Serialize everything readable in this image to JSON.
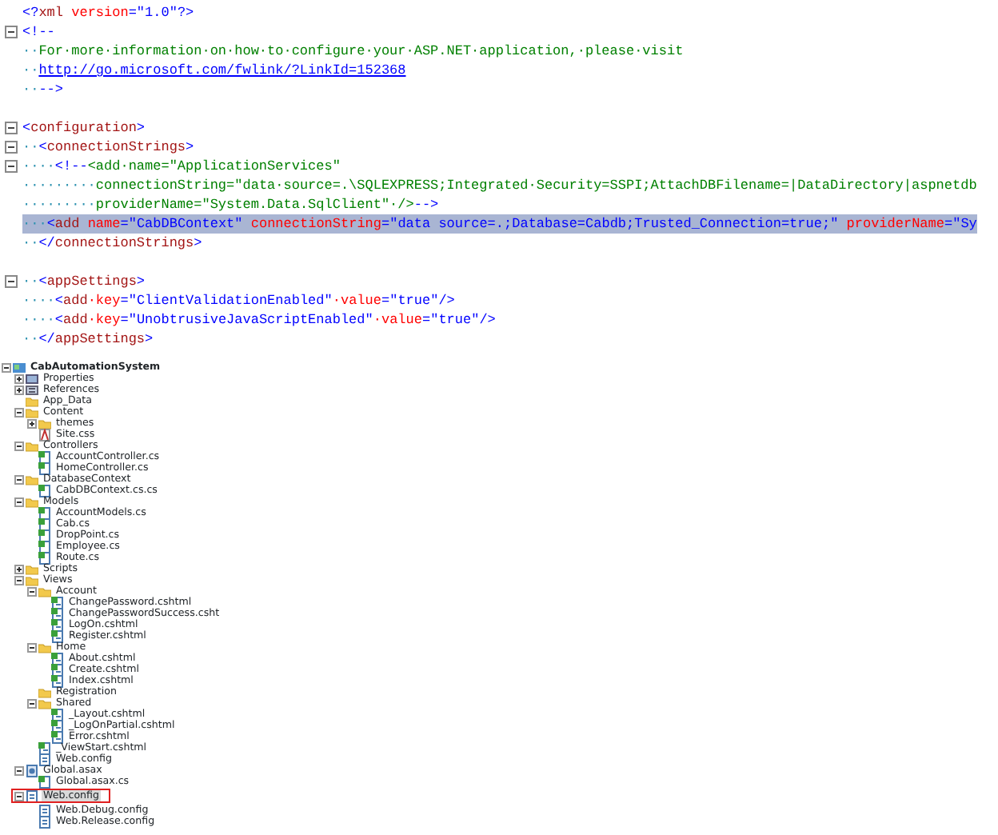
{
  "editor": {
    "lines": [
      {
        "kind": "code",
        "fold": false,
        "segments": [
          {
            "kind": "punct",
            "text": "<?"
          },
          {
            "kind": "tag",
            "text": "xml"
          },
          {
            "kind": "attr",
            "text": " version"
          },
          {
            "kind": "punct",
            "text": "=\""
          },
          {
            "kind": "value",
            "text": "1.0"
          },
          {
            "kind": "punct",
            "text": "\"?>"
          }
        ]
      },
      {
        "kind": "code",
        "fold": true,
        "segments": [
          {
            "kind": "punct",
            "text": "<!--"
          }
        ]
      },
      {
        "kind": "code",
        "fold": false,
        "segments": [
          {
            "kind": "space",
            "text": "··"
          },
          {
            "kind": "comment",
            "text": "For·more·information·on·how·to·configure·your·ASP.NET·application,·please·visit"
          }
        ]
      },
      {
        "kind": "code",
        "fold": false,
        "segments": [
          {
            "kind": "space",
            "text": "··"
          },
          {
            "kind": "link",
            "text": "http://go.microsoft.com/fwlink/?LinkId=152368"
          }
        ]
      },
      {
        "kind": "code",
        "fold": false,
        "segments": [
          {
            "kind": "space",
            "text": "··"
          },
          {
            "kind": "punct",
            "text": "-->"
          }
        ]
      },
      {
        "kind": "blank"
      },
      {
        "kind": "code",
        "fold": true,
        "segments": [
          {
            "kind": "punct",
            "text": "<"
          },
          {
            "kind": "tag",
            "text": "configuration"
          },
          {
            "kind": "punct",
            "text": ">"
          }
        ]
      },
      {
        "kind": "code",
        "fold": true,
        "segments": [
          {
            "kind": "space",
            "text": "··"
          },
          {
            "kind": "punct",
            "text": "<"
          },
          {
            "kind": "tag",
            "text": "connectionStrings"
          },
          {
            "kind": "punct",
            "text": ">"
          }
        ]
      },
      {
        "kind": "code",
        "fold": true,
        "segments": [
          {
            "kind": "space",
            "text": "····"
          },
          {
            "kind": "punct",
            "text": "<!--"
          },
          {
            "kind": "comment",
            "text": "<add·name=\"ApplicationServices\""
          }
        ]
      },
      {
        "kind": "code",
        "fold": false,
        "segments": [
          {
            "kind": "space",
            "text": "·········"
          },
          {
            "kind": "comment",
            "text": "connectionString=\"data·source=.\\SQLEXPRESS;Integrated·Security=SSPI;AttachDBFilename=|DataDirectory|aspnetdb"
          }
        ]
      },
      {
        "kind": "code",
        "fold": false,
        "segments": [
          {
            "kind": "space",
            "text": "·········"
          },
          {
            "kind": "comment",
            "text": "providerName=\"System.Data.SqlClient\"·/>"
          },
          {
            "kind": "punct",
            "text": "-->"
          }
        ]
      },
      {
        "kind": "code",
        "fold": false,
        "highlighted": true,
        "segments": [
          {
            "kind": "space",
            "text": "···"
          },
          {
            "kind": "punct",
            "text": "<"
          },
          {
            "kind": "tag",
            "text": "add"
          },
          {
            "kind": "attr",
            "text": " name"
          },
          {
            "kind": "punct",
            "text": "=\""
          },
          {
            "kind": "value",
            "text": "CabDBContext"
          },
          {
            "kind": "punct",
            "text": "\""
          },
          {
            "kind": "attr",
            "text": " connectionString"
          },
          {
            "kind": "punct",
            "text": "=\""
          },
          {
            "kind": "value",
            "text": "data source=.;Database=Cabdb;Trusted_Connection=true;"
          },
          {
            "kind": "punct",
            "text": "\""
          },
          {
            "kind": "attr",
            "text": " providerName"
          },
          {
            "kind": "punct",
            "text": "=\""
          },
          {
            "kind": "value",
            "text": "Sy"
          }
        ]
      },
      {
        "kind": "code",
        "fold": false,
        "segments": [
          {
            "kind": "space",
            "text": "··"
          },
          {
            "kind": "punct",
            "text": "</"
          },
          {
            "kind": "tag",
            "text": "connectionStrings"
          },
          {
            "kind": "punct",
            "text": ">"
          }
        ]
      },
      {
        "kind": "blank"
      },
      {
        "kind": "code",
        "fold": true,
        "segments": [
          {
            "kind": "space",
            "text": "··"
          },
          {
            "kind": "punct",
            "text": "<"
          },
          {
            "kind": "tag",
            "text": "appSettings"
          },
          {
            "kind": "punct",
            "text": ">"
          }
        ]
      },
      {
        "kind": "code",
        "fold": false,
        "segments": [
          {
            "kind": "space",
            "text": "····"
          },
          {
            "kind": "punct",
            "text": "<"
          },
          {
            "kind": "tag",
            "text": "add"
          },
          {
            "kind": "attr",
            "text": "·key"
          },
          {
            "kind": "punct",
            "text": "=\""
          },
          {
            "kind": "value",
            "text": "ClientValidationEnabled"
          },
          {
            "kind": "punct",
            "text": "\""
          },
          {
            "kind": "attr",
            "text": "·value"
          },
          {
            "kind": "punct",
            "text": "=\""
          },
          {
            "kind": "value",
            "text": "true"
          },
          {
            "kind": "punct",
            "text": "\"/>"
          }
        ]
      },
      {
        "kind": "code",
        "fold": false,
        "segments": [
          {
            "kind": "space",
            "text": "····"
          },
          {
            "kind": "punct",
            "text": "<"
          },
          {
            "kind": "tag",
            "text": "add"
          },
          {
            "kind": "attr",
            "text": "·key"
          },
          {
            "kind": "punct",
            "text": "=\""
          },
          {
            "kind": "value",
            "text": "UnobtrusiveJavaScriptEnabled"
          },
          {
            "kind": "punct",
            "text": "\""
          },
          {
            "kind": "attr",
            "text": "·value"
          },
          {
            "kind": "punct",
            "text": "=\""
          },
          {
            "kind": "value",
            "text": "true"
          },
          {
            "kind": "punct",
            "text": "\"/>"
          }
        ]
      },
      {
        "kind": "code",
        "fold": false,
        "segments": [
          {
            "kind": "space",
            "text": "··"
          },
          {
            "kind": "punct",
            "text": "</"
          },
          {
            "kind": "tag",
            "text": "appSettings"
          },
          {
            "kind": "punct",
            "text": ">"
          }
        ]
      }
    ]
  },
  "solution_tree": [
    {
      "label": "CabAutomationSystem",
      "kind": "project",
      "expanded": true,
      "selected": false,
      "children": [
        {
          "label": "Properties",
          "kind": "properties",
          "expanded": false,
          "selected": false
        },
        {
          "label": "References",
          "kind": "references",
          "expanded": false,
          "selected": false
        },
        {
          "label": "App_Data",
          "kind": "folder",
          "selected": false
        },
        {
          "label": "Content",
          "kind": "folder",
          "expanded": true,
          "selected": false,
          "children": [
            {
              "label": "themes",
              "kind": "folder",
              "expanded": false,
              "selected": false
            },
            {
              "label": "Site.css",
              "kind": "css",
              "selected": false
            }
          ]
        },
        {
          "label": "Controllers",
          "kind": "folder",
          "expanded": true,
          "selected": false,
          "children": [
            {
              "label": "AccountController.cs",
              "kind": "cs",
              "selected": false
            },
            {
              "label": "HomeController.cs",
              "kind": "cs",
              "selected": false
            }
          ]
        },
        {
          "label": "DatabaseContext",
          "kind": "folder",
          "expanded": true,
          "selected": false,
          "children": [
            {
              "label": "CabDBContext.cs.cs",
              "kind": "cs",
              "selected": false
            }
          ]
        },
        {
          "label": "Models",
          "kind": "folder",
          "expanded": true,
          "selected": false,
          "children": [
            {
              "label": "AccountModels.cs",
              "kind": "cs",
              "selected": false
            },
            {
              "label": "Cab.cs",
              "kind": "cs",
              "selected": false
            },
            {
              "label": "DropPoint.cs",
              "kind": "cs",
              "selected": false
            },
            {
              "label": "Employee.cs",
              "kind": "cs",
              "selected": false
            },
            {
              "label": "Route.cs",
              "kind": "cs",
              "selected": false
            }
          ]
        },
        {
          "label": "Scripts",
          "kind": "folder",
          "expanded": false,
          "selected": false
        },
        {
          "label": "Views",
          "kind": "folder",
          "expanded": true,
          "selected": false,
          "children": [
            {
              "label": "Account",
              "kind": "folder",
              "expanded": true,
              "selected": false,
              "children": [
                {
                  "label": "ChangePassword.cshtml",
                  "kind": "cshtml",
                  "selected": false
                },
                {
                  "label": "ChangePasswordSuccess.csht",
                  "kind": "cshtml",
                  "selected": false
                },
                {
                  "label": "LogOn.cshtml",
                  "kind": "cshtml",
                  "selected": false
                },
                {
                  "label": "Register.cshtml",
                  "kind": "cshtml",
                  "selected": false
                }
              ]
            },
            {
              "label": "Home",
              "kind": "folder",
              "expanded": true,
              "selected": false,
              "children": [
                {
                  "label": "About.cshtml",
                  "kind": "cshtml",
                  "selected": false
                },
                {
                  "label": "Create.cshtml",
                  "kind": "cshtml",
                  "selected": false
                },
                {
                  "label": "Index.cshtml",
                  "kind": "cshtml",
                  "selected": false
                }
              ]
            },
            {
              "label": "Registration",
              "kind": "folder",
              "selected": false
            },
            {
              "label": "Shared",
              "kind": "folder",
              "expanded": true,
              "selected": false,
              "children": [
                {
                  "label": "_Layout.cshtml",
                  "kind": "cshtml",
                  "selected": false
                },
                {
                  "label": "_LogOnPartial.cshtml",
                  "kind": "cshtml",
                  "selected": false
                },
                {
                  "label": "Error.cshtml",
                  "kind": "cshtml",
                  "selected": false
                }
              ]
            },
            {
              "label": "_ViewStart.cshtml",
              "kind": "cshtml",
              "selected": false
            },
            {
              "label": "Web.config",
              "kind": "config",
              "selected": false
            }
          ]
        },
        {
          "label": "Global.asax",
          "kind": "asax",
          "expanded": true,
          "selected": false,
          "children": [
            {
              "label": "Global.asax.cs",
              "kind": "cs",
              "selected": false
            }
          ]
        },
        {
          "label": "Web.config",
          "kind": "config",
          "expanded": true,
          "selected": true,
          "children": [
            {
              "label": "Web.Debug.config",
              "kind": "config",
              "selected": false
            },
            {
              "label": "Web.Release.config",
              "kind": "config",
              "selected": false
            }
          ]
        }
      ]
    }
  ]
}
